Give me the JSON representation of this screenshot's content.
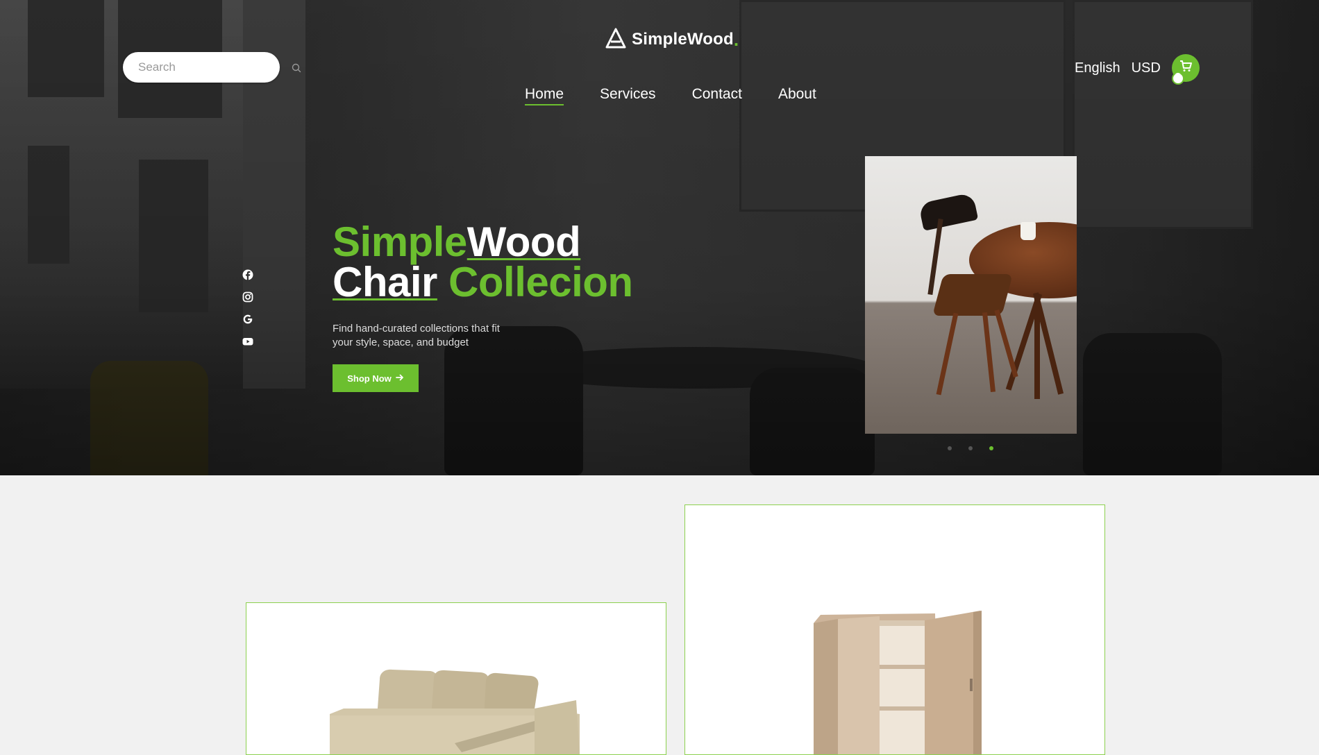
{
  "search": {
    "placeholder": "Search"
  },
  "logo": {
    "text": "SimpleWood",
    "dot": "."
  },
  "nav": {
    "items": [
      {
        "label": "Home",
        "active": true
      },
      {
        "label": "Services",
        "active": false
      },
      {
        "label": "Contact",
        "active": false
      },
      {
        "label": "About",
        "active": false
      }
    ]
  },
  "utility": {
    "language": "English",
    "currency": "USD",
    "cart_count": "0"
  },
  "social": [
    "facebook-icon",
    "instagram-icon",
    "google-icon",
    "youtube-icon"
  ],
  "hero": {
    "headline_simple": "Simple",
    "headline_wood": "Wood",
    "headline_chair": "Chair",
    "headline_collection": "Collecion",
    "subtitle": "Find hand-curated collections that fit your style, space, and budget",
    "cta_label": "Shop Now",
    "slides": 3,
    "active_slide": 3
  },
  "colors": {
    "accent": "#6cbf2f",
    "hero_bg": "#2e2e2e",
    "page_bg": "#f1f1f1"
  },
  "products": [
    {
      "icon": "sofa-image"
    },
    {
      "icon": "cabinet-image"
    }
  ]
}
